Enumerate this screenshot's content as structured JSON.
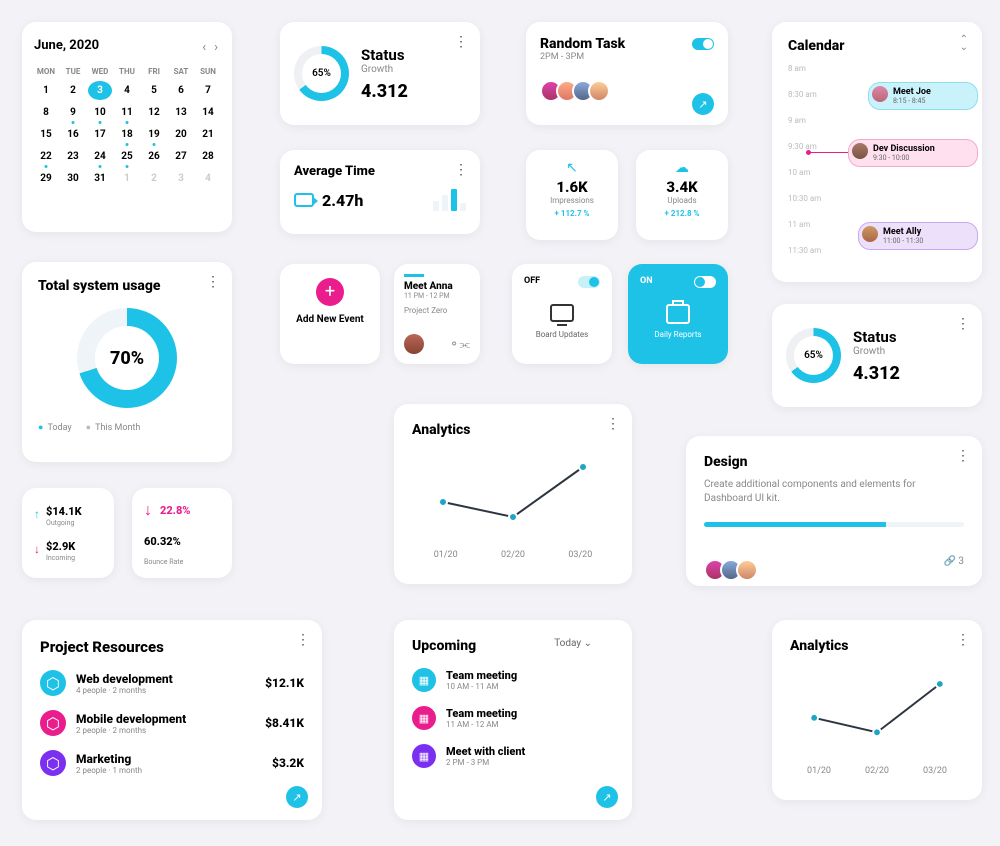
{
  "calendar": {
    "title": "June, 2020",
    "dows": [
      "MON",
      "TUE",
      "WED",
      "THU",
      "FRI",
      "SAT",
      "SUN"
    ],
    "days": [
      1,
      2,
      3,
      4,
      5,
      6,
      7,
      8,
      9,
      10,
      11,
      12,
      13,
      14,
      15,
      16,
      17,
      18,
      19,
      20,
      21,
      22,
      23,
      24,
      25,
      26,
      27,
      28,
      29,
      30,
      31,
      1,
      2,
      3,
      4
    ],
    "selected": 3,
    "dotted": [
      9,
      10,
      11,
      18,
      19,
      22,
      24,
      25
    ]
  },
  "status1": {
    "pct": "65%",
    "label": "Status",
    "sub": "Growth",
    "value": "4.312"
  },
  "random_task": {
    "title": "Random Task",
    "time": "2PM - 3PM"
  },
  "caltime": {
    "title": "Calendar",
    "slots": [
      "8 am",
      "8:30 am",
      "9 am",
      "9:30 am",
      "10 am",
      "10:30 am",
      "11 am",
      "11:30 am"
    ],
    "events": [
      {
        "name": "Meet Joe",
        "time": "8:15 - 8:45"
      },
      {
        "name": "Dev Discussion",
        "time": "9:30 - 10:00"
      },
      {
        "name": "Meet Ally",
        "time": "11:00 - 11:30"
      }
    ]
  },
  "avg_time": {
    "title": "Average Time",
    "value": "2.47h"
  },
  "mstat1": {
    "value": "1.6K",
    "label": "Impressions",
    "delta": "+ 112.7 %"
  },
  "mstat2": {
    "value": "3.4K",
    "label": "Uploads",
    "delta": "+ 212.8 %"
  },
  "tsu": {
    "title": "Total system usage",
    "pct": "70%",
    "leg1": "Today",
    "leg2": "This Month"
  },
  "addne": {
    "label": "Add New Event"
  },
  "manna": {
    "name": "Meet Anna",
    "time": "11 PM - 12 PM",
    "project": "Project Zero"
  },
  "offcard": {
    "state": "OFF",
    "label": "Board Updates"
  },
  "oncard": {
    "state": "ON",
    "label": "Daily Reports"
  },
  "status2": {
    "pct": "65%",
    "label": "Status",
    "sub": "Growth",
    "value": "4.312"
  },
  "fin": {
    "out_v": "$14.1K",
    "out_l": "Outgoing",
    "in_v": "$2.9K",
    "in_l": "Incoming"
  },
  "fin2": {
    "v1": "22.8%",
    "v2": "60.32%",
    "l2": "Bounce Rate"
  },
  "analytics": {
    "title": "Analytics",
    "labels": [
      "01/20",
      "02/20",
      "03/20"
    ]
  },
  "design": {
    "title": "Design",
    "desc": "Create additional components and elements for Dashboard UI kit.",
    "attachments": "3"
  },
  "pres": {
    "title": "Project Resources",
    "items": [
      {
        "name": "Web development",
        "sub": "4 people · 2 months",
        "amt": "$12.1K"
      },
      {
        "name": "Mobile development",
        "sub": "2 people · 2 months",
        "amt": "$8.41K"
      },
      {
        "name": "Marketing",
        "sub": "2 people · 1 month",
        "amt": "$3.2K"
      }
    ]
  },
  "upc": {
    "title": "Upcoming",
    "filter": "Today",
    "items": [
      {
        "name": "Team meeting",
        "time": "10 AM - 11 AM"
      },
      {
        "name": "Team meeting",
        "time": "11 AM - 12 AM"
      },
      {
        "name": "Meet with client",
        "time": "2 PM - 3 PM"
      }
    ]
  },
  "analytics2": {
    "title": "Analytics",
    "labels": [
      "01/20",
      "02/20",
      "03/20"
    ]
  },
  "chart_data": [
    {
      "type": "line",
      "title": "Analytics",
      "x": [
        "01/20",
        "02/20",
        "03/20"
      ],
      "values": [
        40,
        30,
        70
      ]
    },
    {
      "type": "line",
      "title": "Analytics",
      "x": [
        "01/20",
        "02/20",
        "03/20"
      ],
      "values": [
        40,
        30,
        70
      ]
    }
  ]
}
